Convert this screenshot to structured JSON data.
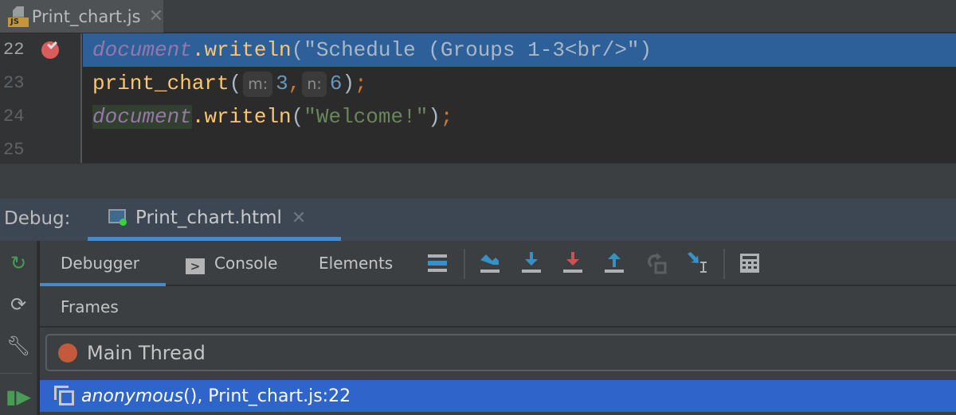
{
  "editor_tab": {
    "icon_label": "JS",
    "filename": "Print_chart.js",
    "close": "✕"
  },
  "gutter": {
    "lines": [
      "22",
      "23",
      "24",
      "25"
    ]
  },
  "code": {
    "line22": {
      "obj": "document",
      "dot": ".",
      "method": "writeln",
      "open": "(",
      "string": "\"Schedule (Groups 1-3<br/>\"",
      "close": ")"
    },
    "line23": {
      "fn": "print_chart",
      "open": "(",
      "hint_m": "m:",
      "val_m": "3",
      "comma": ",",
      "hint_n": "n:",
      "val_n": "6",
      "close": ")",
      "semi": ";"
    },
    "line24": {
      "obj": "document",
      "dot": ".",
      "method": "writeln",
      "open": "(",
      "string": "\"Welcome!\"",
      "close": ")",
      "semi": ";"
    }
  },
  "debug": {
    "label": "Debug:",
    "session_tab": "Print_chart.html",
    "close": "✕",
    "tabs": [
      {
        "label": "Debugger"
      },
      {
        "label": "Console"
      },
      {
        "label": "Elements"
      }
    ],
    "console_glyph": ">",
    "frames_label": "Frames",
    "thread": "Main Thread",
    "frame": {
      "function": "anonymous",
      "rest": "(), Print_chart.js:22"
    }
  },
  "colors": {
    "accent": "#4a88c7",
    "selection": "#2f65ca",
    "breakpoint": "#db5c5c"
  }
}
